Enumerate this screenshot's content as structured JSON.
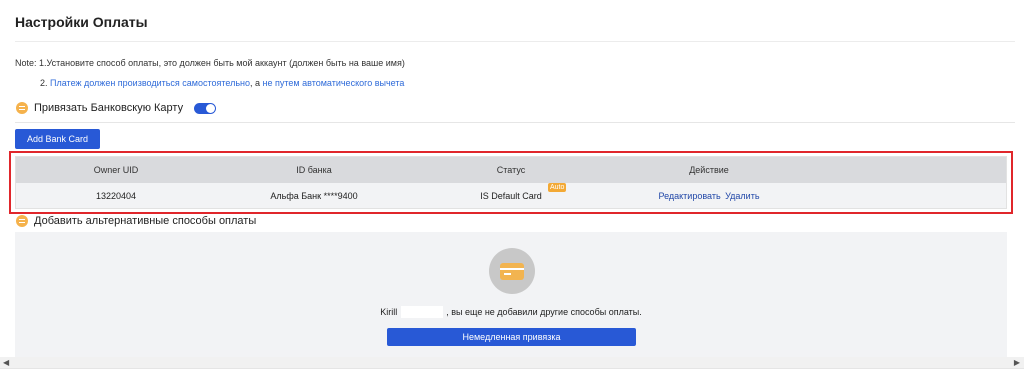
{
  "page": {
    "title": "Настройки Оплаты"
  },
  "note": {
    "line1": "Note: 1.Установите способ оплаты, это должен быть мой аккаунт (должен быть на ваше имя)",
    "line2_prefix": "2. ",
    "line2_part1": "Платеж должен производиться самостоятельно",
    "line2_sep": ", а ",
    "line2_part2": "не путем автоматического вычета"
  },
  "bank_section": {
    "label": "Привязать Банковскую Карту",
    "toggle_on": true,
    "add_button": "Add Bank Card"
  },
  "table": {
    "headers": [
      "Owner UID",
      "ID банка",
      "Статус",
      "Действие"
    ],
    "rows": [
      {
        "owner_uid": "13220404",
        "bank_id": "Альфа Банк ****9400",
        "status": "IS Default Card",
        "badge": "Auto",
        "actions": [
          "Редактировать",
          "Удалить"
        ]
      }
    ]
  },
  "alt_section": {
    "label": "Добавить альтернативные способы оплаты",
    "user_name": "Kirill",
    "empty_message": ", вы еще не добавили другие способы оплаты.",
    "bind_button": "Немедленная привязка"
  },
  "colors": {
    "primary": "#2859d6",
    "link": "#2f6bd9",
    "highlight": "#e0262b",
    "badge": "#f3a935",
    "coin": "#f5b24c"
  }
}
